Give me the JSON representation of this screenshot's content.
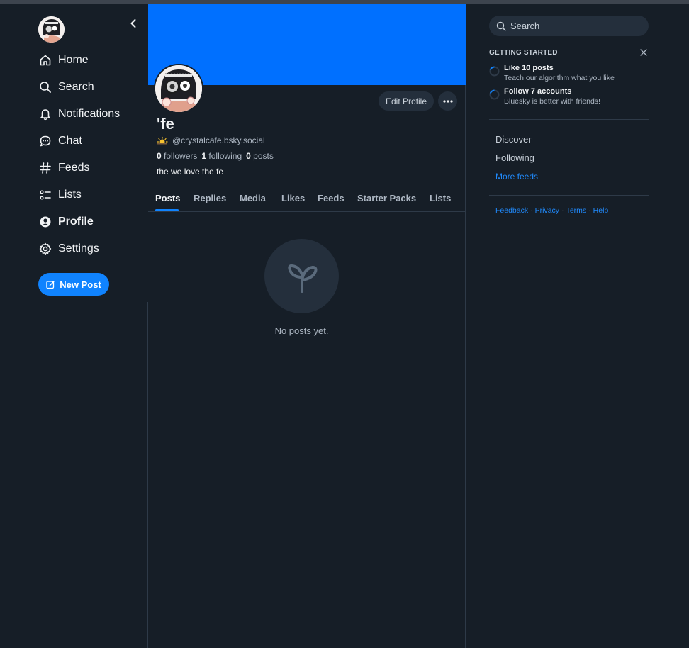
{
  "nav": {
    "items": [
      {
        "label": "Home",
        "icon": "home-icon"
      },
      {
        "label": "Search",
        "icon": "search-icon"
      },
      {
        "label": "Notifications",
        "icon": "bell-icon"
      },
      {
        "label": "Chat",
        "icon": "chat-icon"
      },
      {
        "label": "Feeds",
        "icon": "hash-icon"
      },
      {
        "label": "Lists",
        "icon": "list-icon"
      },
      {
        "label": "Profile",
        "icon": "user-circle-icon"
      },
      {
        "label": "Settings",
        "icon": "gear-icon"
      }
    ],
    "active": "Profile",
    "new_post_label": "New Post"
  },
  "profile": {
    "display_name": "'fe",
    "handle": "@crystalcafe.bsky.social",
    "followers_count": "0",
    "followers_label": "followers",
    "following_count": "1",
    "following_label": "following",
    "posts_count": "0",
    "posts_label": "posts",
    "bio": "the we love the fe",
    "edit_profile_label": "Edit Profile",
    "banner_color": "#0070ff"
  },
  "tabs": [
    "Posts",
    "Replies",
    "Media",
    "Likes",
    "Feeds",
    "Starter Packs",
    "Lists"
  ],
  "active_tab": "Posts",
  "empty_state": {
    "text": "No posts yet.",
    "icon": "sprout-icon"
  },
  "sidebar": {
    "search_placeholder": "Search",
    "getting_started": {
      "title": "GETTING STARTED",
      "items": [
        {
          "title": "Like 10 posts",
          "subtitle": "Teach our algorithm what you like"
        },
        {
          "title": "Follow 7 accounts",
          "subtitle": "Bluesky is better with friends!"
        }
      ]
    },
    "feeds": [
      "Discover",
      "Following"
    ],
    "more_feeds_label": "More feeds",
    "footer": [
      "Feedback",
      "Privacy",
      "Terms",
      "Help"
    ],
    "footer_separator": "·"
  },
  "colors": {
    "background": "#161e27",
    "accent": "#1083fe",
    "link": "#208bfe"
  }
}
